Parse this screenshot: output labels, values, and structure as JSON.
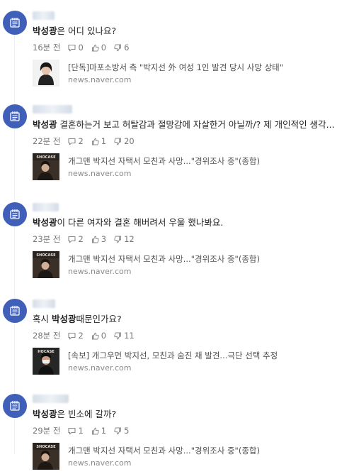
{
  "comments": [
    {
      "highlight": "박성광",
      "body_rest": "은 어디 있나요?",
      "time": "16분 전",
      "replies": "0",
      "likes": "0",
      "dislikes": "6",
      "link_title": "[단독]마포소방서 측 \"박지선 外 여성 1인 발견 당시 사망 상태\"",
      "link_domain": "news.naver.com",
      "thumb_caption": ""
    },
    {
      "highlight": "박성광",
      "body_rest": " 결혼하는거 보고 허탈감과 절망감에 자살한거 아닐까/? 제 개인적인 생각...",
      "time": "22분 전",
      "replies": "2",
      "likes": "1",
      "dislikes": "20",
      "link_title": "개그맨 박지선 자택서 모친과 사망...\"경위조사 중\"(종합)",
      "link_domain": "news.naver.com",
      "thumb_caption": "SHOCASE"
    },
    {
      "highlight": "박성광",
      "body_rest": "이 다른 여자와 결혼 해버려서 우울 했나봐요.",
      "time": "23분 전",
      "replies": "2",
      "likes": "3",
      "dislikes": "12",
      "link_title": "개그맨 박지선 자택서 모친과 사망...\"경위조사 중\"(종합)",
      "link_domain": "news.naver.com",
      "thumb_caption": "SHOCASE"
    },
    {
      "prefix": "혹시 ",
      "highlight": "박성광",
      "body_rest": "때문인가요?",
      "time": "28분 전",
      "replies": "2",
      "likes": "0",
      "dislikes": "11",
      "link_title": "[속보] 개그우먼 박지선, 모친과 숨진 채 발견...극단 선택 추정",
      "link_domain": "news.naver.com",
      "thumb_caption": "HOCASE"
    },
    {
      "highlight": "박성광",
      "body_rest": "은 빈소에 갈까?",
      "time": "29분 전",
      "replies": "1",
      "likes": "1",
      "dislikes": "5",
      "link_title": "개그맨 박지선 자택서 모친과 사망...\"경위조사 중\"(종합)",
      "link_domain": "news.naver.com",
      "thumb_caption": "SHOCASE"
    }
  ],
  "colors": {
    "avatar": "#3f5fb9",
    "text": "#222222",
    "meta": "#777777"
  },
  "icons": {
    "avatar": "notepad-icon",
    "reply": "reply-icon",
    "like": "thumbs-up-icon",
    "dislike": "thumbs-down-icon"
  }
}
